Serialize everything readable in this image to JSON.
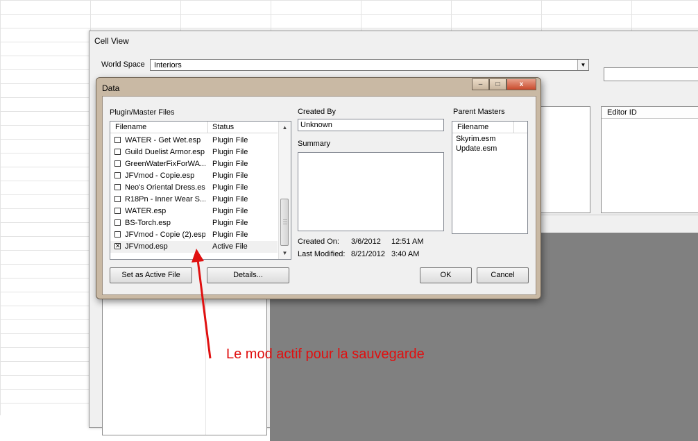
{
  "cell_view": {
    "title": "Cell View",
    "world_space_label": "World Space",
    "world_space_value": "Interiors",
    "editor_id_header": "Editor ID"
  },
  "data_dialog": {
    "title": "Data",
    "caption_buttons": {
      "minimize": "–",
      "maximize": "□",
      "close": "x"
    },
    "plugin_group_label": "Plugin/Master Files",
    "plugin_columns": {
      "filename": "Filename",
      "status": "Status"
    },
    "plugins": [
      {
        "filename": "WATER - Get Wet.esp",
        "status": "Plugin File",
        "checked": false
      },
      {
        "filename": "Guild Duelist Armor.esp",
        "status": "Plugin File",
        "checked": false
      },
      {
        "filename": "GreenWaterFixForWA...",
        "status": "Plugin File",
        "checked": false
      },
      {
        "filename": "JFVmod - Copie.esp",
        "status": "Plugin File",
        "checked": false
      },
      {
        "filename": "Neo's Oriental Dress.esp",
        "status": "Plugin File",
        "checked": false
      },
      {
        "filename": "R18Pn - Inner Wear S...",
        "status": "Plugin File",
        "checked": false
      },
      {
        "filename": "WATER.esp",
        "status": "Plugin File",
        "checked": false
      },
      {
        "filename": "BS-Torch.esp",
        "status": "Plugin File",
        "checked": false
      },
      {
        "filename": "JFVmod - Copie (2).esp",
        "status": "Plugin File",
        "checked": false
      },
      {
        "filename": "JFVmod.esp",
        "status": "Active File",
        "checked": true
      }
    ],
    "created_by_label": "Created By",
    "created_by_value": "Unknown",
    "summary_label": "Summary",
    "summary_value": "",
    "created_on_label": "Created On:",
    "created_on_date": "3/6/2012",
    "created_on_time": "12:51 AM",
    "last_modified_label": "Last Modified:",
    "last_modified_date": "8/21/2012",
    "last_modified_time": "3:40 AM",
    "parent_masters_label": "Parent Masters",
    "masters_column": "Filename",
    "masters": [
      "Skyrim.esm",
      "Update.esm"
    ],
    "buttons": {
      "set_active": "Set as Active File",
      "details": "Details...",
      "ok": "OK",
      "cancel": "Cancel"
    }
  },
  "annotation": {
    "text": "Le mod actif pour la sauvegarde",
    "color": "#e01010"
  }
}
